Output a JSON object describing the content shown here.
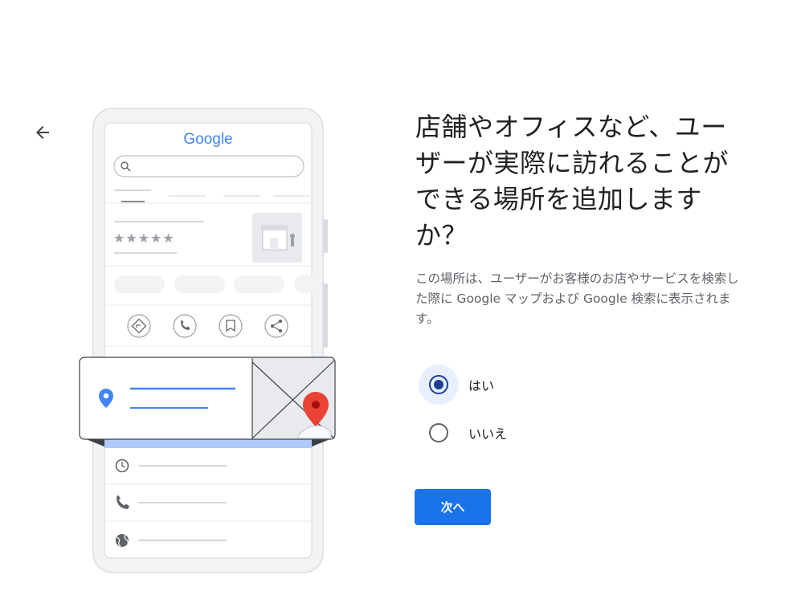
{
  "nav": {
    "back_icon": "arrow-left-icon"
  },
  "illustration": {
    "logo_text": "Google",
    "rating_stars": "★★★★★",
    "action_icons": [
      "directions-icon",
      "phone-icon",
      "bookmark-icon",
      "share-icon"
    ],
    "detail_icons": [
      "clock-icon",
      "phone-icon",
      "globe-icon"
    ]
  },
  "main": {
    "title": "店舗やオフィスなど、ユーザーが実際に訪れることができる場所を追加しますか？",
    "description": "この場所は、ユーザーがお客様のお店やサービスを検索した際に Google マップおよび Google 検索に表示されます。",
    "options": [
      {
        "label": "はい",
        "selected": true
      },
      {
        "label": "いいえ",
        "selected": false
      }
    ],
    "next_label": "次へ"
  },
  "colors": {
    "primary": "#1a73e8",
    "selected_halo": "#e8f0fe",
    "radio_selected": "#1a3f8f",
    "pin_red": "#ea4335",
    "pin_blue": "#4285f4"
  }
}
